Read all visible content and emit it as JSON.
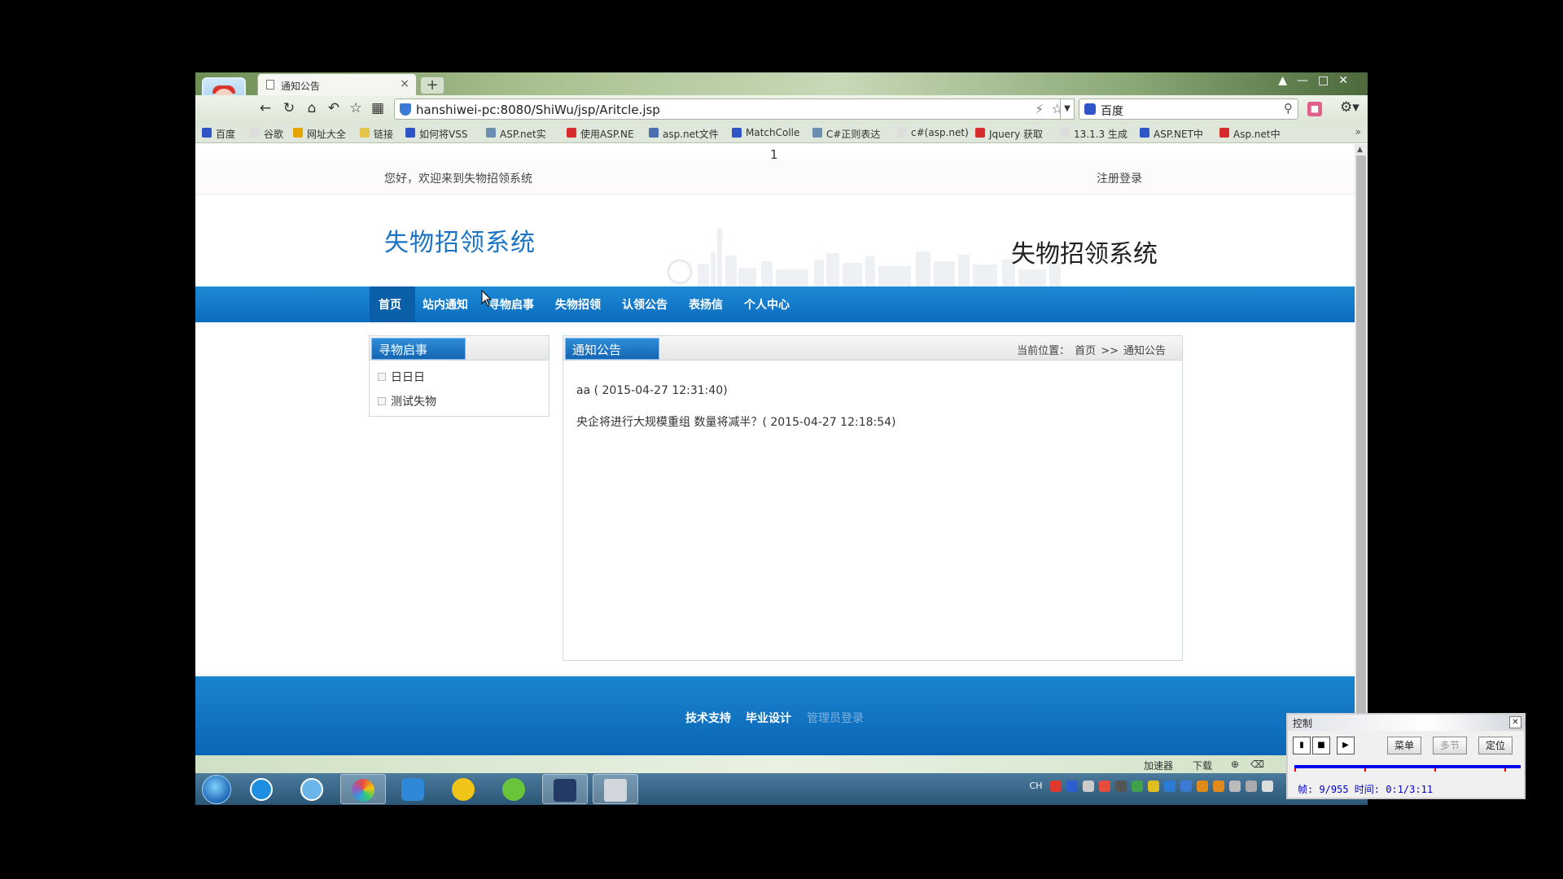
{
  "browser": {
    "tab_title": "通知公告",
    "url": "hanshiwei-pc:8080/ShiWu/jsp/Aritcle.jsp",
    "search_engine": "百度",
    "bookmarks": [
      "百度",
      "谷歌",
      "网址大全",
      "链接",
      "如何将VSS",
      "ASP.net实",
      "使用ASP.NE",
      "asp.net文件",
      "MatchColle",
      "C#正则表达",
      "c#(asp.net)",
      "Jquery 获取",
      "13.1.3 生成",
      "ASP.NET中",
      "Asp.net中"
    ],
    "bookmark_colors": [
      "#2d55c8",
      "#bbb",
      "#e6a400",
      "#e6c44a",
      "#2d55c8",
      "#6a8fb0",
      "#d62b2b",
      "#4a6fb0",
      "#2d55c8",
      "#6a8fb0",
      "#bbb",
      "#d62b2b",
      "#bbb",
      "#2d55c8",
      "#d62b2b"
    ]
  },
  "page": {
    "page_number": "1",
    "welcome": "您好，欢迎来到失物招领系统",
    "register_login": "注册登录",
    "logo": "失物招领系统",
    "header_title": "失物招领系统",
    "nav": [
      "首页",
      "站内通知",
      "寻物启事",
      "失物招领",
      "认领公告",
      "表扬信",
      "个人中心"
    ],
    "sidebar": {
      "title": "寻物启事",
      "items": [
        "日日日",
        "测试失物"
      ]
    },
    "content": {
      "title": "通知公告",
      "breadcrumb_label": "当前位置：",
      "breadcrumb_home": "首页",
      "breadcrumb_sep": ">>",
      "breadcrumb_current": "通知公告",
      "articles": [
        "aa ( 2015-04-27 12:31:40)",
        "央企将进行大规模重组 数量将减半？( 2015-04-27 12:18:54)"
      ]
    },
    "footer": [
      "技术支持",
      "毕业设计",
      "管理员登录"
    ]
  },
  "statusbar": {
    "accelerator": "加速器",
    "download": "下载"
  },
  "tray": {
    "ime": "CH"
  },
  "recorder": {
    "title": "控制",
    "menu": "菜单",
    "multi": "多节",
    "locate": "定位",
    "info": "帧: 9/955 时间: 0:1/3:11"
  }
}
